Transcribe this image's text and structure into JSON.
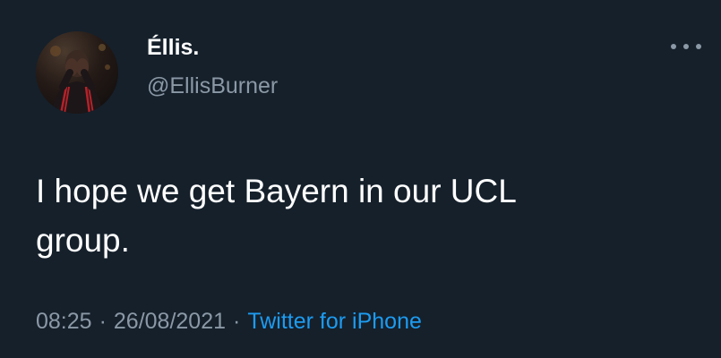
{
  "tweet": {
    "author": {
      "display_name": "Éllis.",
      "handle": "@EllisBurner",
      "avatar_icon": "person-photo-avatar"
    },
    "text": "I hope we get Bayern in our UCL\ngroup.",
    "time": "08:25",
    "date": "26/08/2021",
    "separator": "·",
    "source": "Twitter for iPhone",
    "more_icon": "more-horizontal-icon"
  },
  "colors": {
    "background": "#15202b",
    "primary_text": "#ffffff",
    "secondary_text": "#8b98a5",
    "link": "#1d9bf0"
  }
}
